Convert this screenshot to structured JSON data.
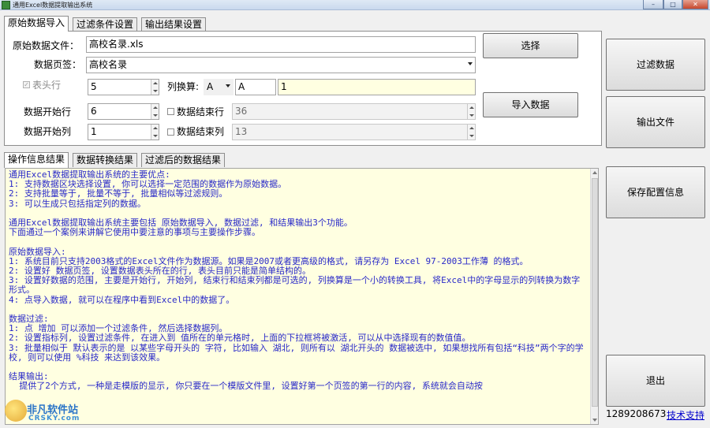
{
  "window": {
    "title": "通用Excel数据提取输出系统",
    "min_label": "–",
    "max_label": "□",
    "close_label": "✕"
  },
  "top_tabs": [
    {
      "label": "原始数据导入"
    },
    {
      "label": "过滤条件设置"
    },
    {
      "label": "输出结果设置"
    }
  ],
  "import": {
    "file_label": "原始数据文件：",
    "file_value": "高校名录.xls",
    "sheet_label": "数据页签：",
    "sheet_value": "高校名录",
    "header_label": "表头行",
    "header_value": "5",
    "colconv_label": "列换算:",
    "colconv_select": "A",
    "colconv_input": "A",
    "colconv_result": "1",
    "start_row_label": "数据开始行",
    "start_row_value": "6",
    "end_row_label": "数据结束行",
    "end_row_value": "36",
    "start_col_label": "数据开始列",
    "start_col_value": "1",
    "end_col_label": "数据结束列",
    "end_col_value": "13",
    "select_button": "选择",
    "import_button": "导入数据"
  },
  "right_buttons": {
    "filter": "过滤数据",
    "export": "输出文件",
    "save_config": "保存配置信息",
    "exit": "退出"
  },
  "bottom_tabs": [
    {
      "label": "操作信息结果"
    },
    {
      "label": "数据转换结果"
    },
    {
      "label": "过滤后的数据结果"
    }
  ],
  "log_lines": [
    "通用Excel数据提取输出系统的主要优点:",
    "1: 支持数据区块选择设置, 你可以选择一定范围的数据作为原始数据。",
    "2: 支持批量等于, 批量不等于, 批量相似等过滤规则。",
    "3: 可以生成只包括指定列的数据。",
    "",
    "通用Excel数据提取输出系统主要包括 原始数据导入, 数据过滤, 和结果输出3个功能。",
    "下面通过一个案例来讲解它使用中要注意的事项与主要操作步骤。",
    "",
    "原始数据导入:",
    "1: 系统目前只支持2003格式的Excel文件作为数据源。如果是2007或者更高级的格式, 请另存为 Excel 97-2003工作薄 的格式。",
    "2: 设置好 数据页签, 设置数据表头所在的行, 表头目前只能是简单结构的。",
    "3: 设置好数据的范围, 主要是开始行, 开始列, 结束行和结束列都是可选的, 列换算是一个小的转换工具, 将Excel中的字母显示的列转换为数字形式。",
    "4: 点导入数据, 就可以在程序中看到Excel中的数据了。",
    "",
    "数据过滤:",
    "1: 点 增加 可以添加一个过滤条件, 然后选择数据列。",
    "2: 设置指标列, 设置过滤条件, 在进入到 值所在的单元格时, 上面的下拉框将被激活, 可以从中选择现有的数值值。",
    "3: 批量相似于 默认表示的是 以某些字母开头的 字符, 比如输入 湖北, 则所有以 湖北开头的 数据被选中, 如果想找所有包括“科技”两个字的学校, 则可以使用 %科技 来达到该效果。",
    "",
    "结果输出:",
    "  提供了2个方式, 一种是走模版的显示, 你只要在一个模版文件里, 设置好第一个页签的第一行的内容, 系统就会自动按"
  ],
  "watermark": {
    "name": "非凡软件站",
    "sub": "CRSKY.com"
  },
  "status": {
    "number": "1289208673",
    "link": "技术支持"
  }
}
